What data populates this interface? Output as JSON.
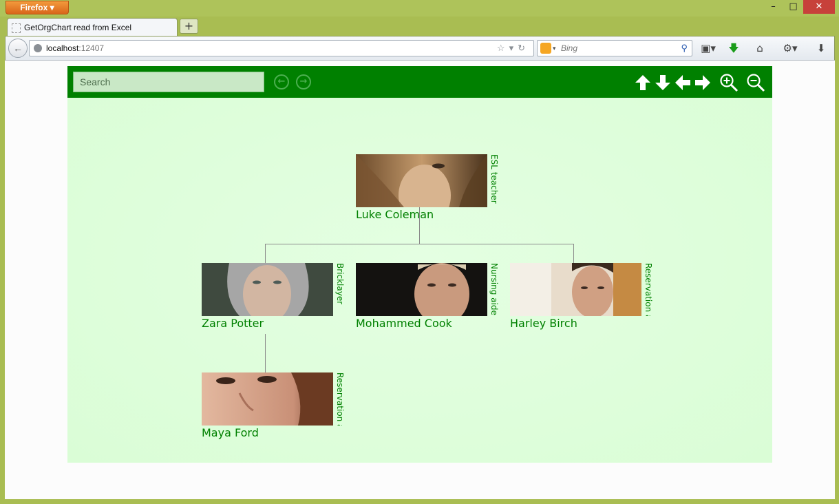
{
  "browser": {
    "menu_label": "Firefox",
    "tab_title": "GetOrgChart read from Excel",
    "new_tab_label": "+",
    "url_host": "localhost",
    "url_port": ":12407",
    "search_engine": "Bing",
    "window_controls": {
      "minimize": "–",
      "maximize": "□",
      "close": "✕"
    }
  },
  "toolbar": {
    "search_placeholder": "Search",
    "accent_color": "#008000",
    "icons": [
      "previous-icon",
      "next-icon",
      "move-up-icon",
      "move-down-icon",
      "move-left-icon",
      "move-right-icon",
      "zoom-in-icon",
      "zoom-out-icon"
    ]
  },
  "org": {
    "background": "#dafdd6",
    "nodes": [
      {
        "id": "luke",
        "name": "Luke Coleman",
        "title": "ESL teacher"
      },
      {
        "id": "zara",
        "name": "Zara Potter",
        "title": "Bricklayer"
      },
      {
        "id": "mohammed",
        "name": "Mohammed Cook",
        "title": "Nursing aide"
      },
      {
        "id": "harley",
        "name": "Harley Birch",
        "title": "Reservation a..."
      },
      {
        "id": "maya",
        "name": "Maya Ford",
        "title": "Reservation a..."
      }
    ]
  }
}
